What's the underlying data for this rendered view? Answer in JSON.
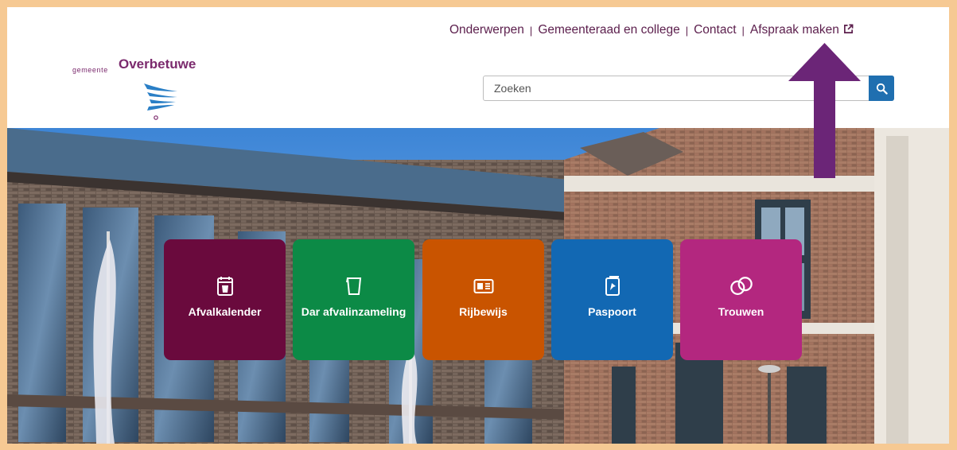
{
  "topnav": {
    "items": [
      {
        "label": "Onderwerpen"
      },
      {
        "label": "Gemeenteraad en college"
      },
      {
        "label": "Contact"
      },
      {
        "label": "Afspraak maken",
        "external": true
      }
    ],
    "separator": "|"
  },
  "logo": {
    "prefix": "gemeente",
    "name": "Overbetuwe"
  },
  "search": {
    "placeholder": "Zoeken",
    "button_icon": "search-icon"
  },
  "tiles": [
    {
      "label": "Afvalkalender",
      "icon": "waste-bin-calendar-icon",
      "color": "#6a0a3d"
    },
    {
      "label": "Dar afvalinzameling",
      "icon": "waste-container-icon",
      "color": "#0c8a46"
    },
    {
      "label": "Rijbewijs",
      "icon": "driving-license-icon",
      "color": "#c95400"
    },
    {
      "label": "Paspoort",
      "icon": "passport-icon",
      "color": "#1268b3"
    },
    {
      "label": "Trouwen",
      "icon": "wedding-rings-icon",
      "color": "#b3277f"
    }
  ],
  "colors": {
    "frame": "#f6c993",
    "brand": "#7b2a6d",
    "arrow": "#6b2577"
  }
}
